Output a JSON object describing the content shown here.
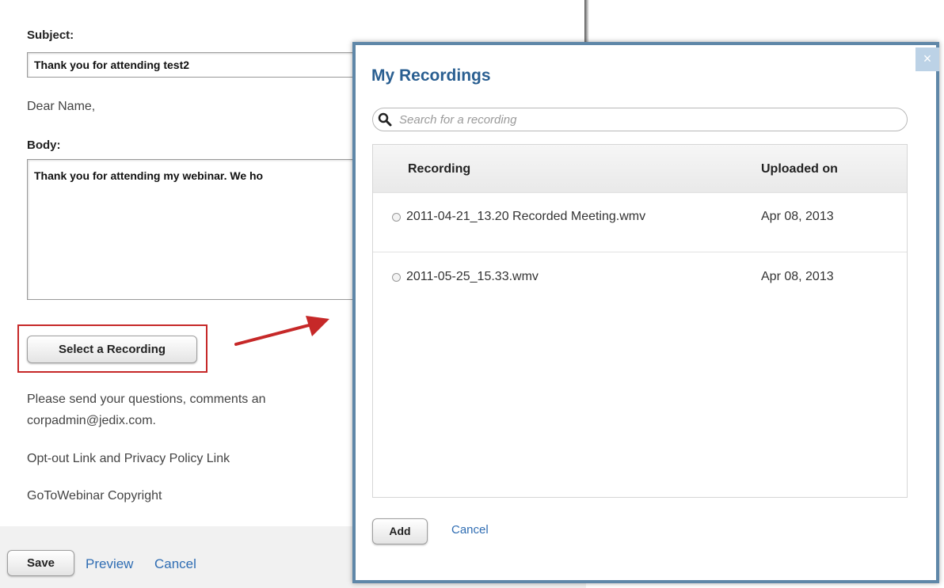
{
  "form": {
    "subject_label": "Subject:",
    "subject_value": "Thank you for attending test2",
    "greeting": "Dear Name,",
    "body_label": "Body:",
    "body_value": "Thank you for attending my webinar. We ho",
    "select_recording_label": "Select a Recording",
    "questions_line1": "Please send your questions, comments an",
    "questions_line2": "corpadmin@jedix.com.",
    "optout_text": "Opt-out Link and Privacy Policy Link",
    "copyright_text": "GoToWebinar Copyright",
    "save_label": "Save",
    "preview_label": "Preview",
    "cancel_label": "Cancel"
  },
  "modal": {
    "title": "My Recordings",
    "close_glyph": "×",
    "search_placeholder": "Search for a recording",
    "columns": [
      "Recording",
      "Uploaded on"
    ],
    "rows": [
      {
        "recording": "2011-04-21_13.20 Recorded Meeting.wmv",
        "uploaded": "Apr 08, 2013",
        "selected": false
      },
      {
        "recording": "2011-05-25_15.33.wmv",
        "uploaded": "Apr 08, 2013",
        "selected": false
      }
    ],
    "add_label": "Add",
    "cancel_label": "Cancel"
  },
  "colors": {
    "modal_border": "#5f87a8",
    "title": "#2a5f91",
    "link": "#2f6db3",
    "highlight": "#c62828"
  }
}
